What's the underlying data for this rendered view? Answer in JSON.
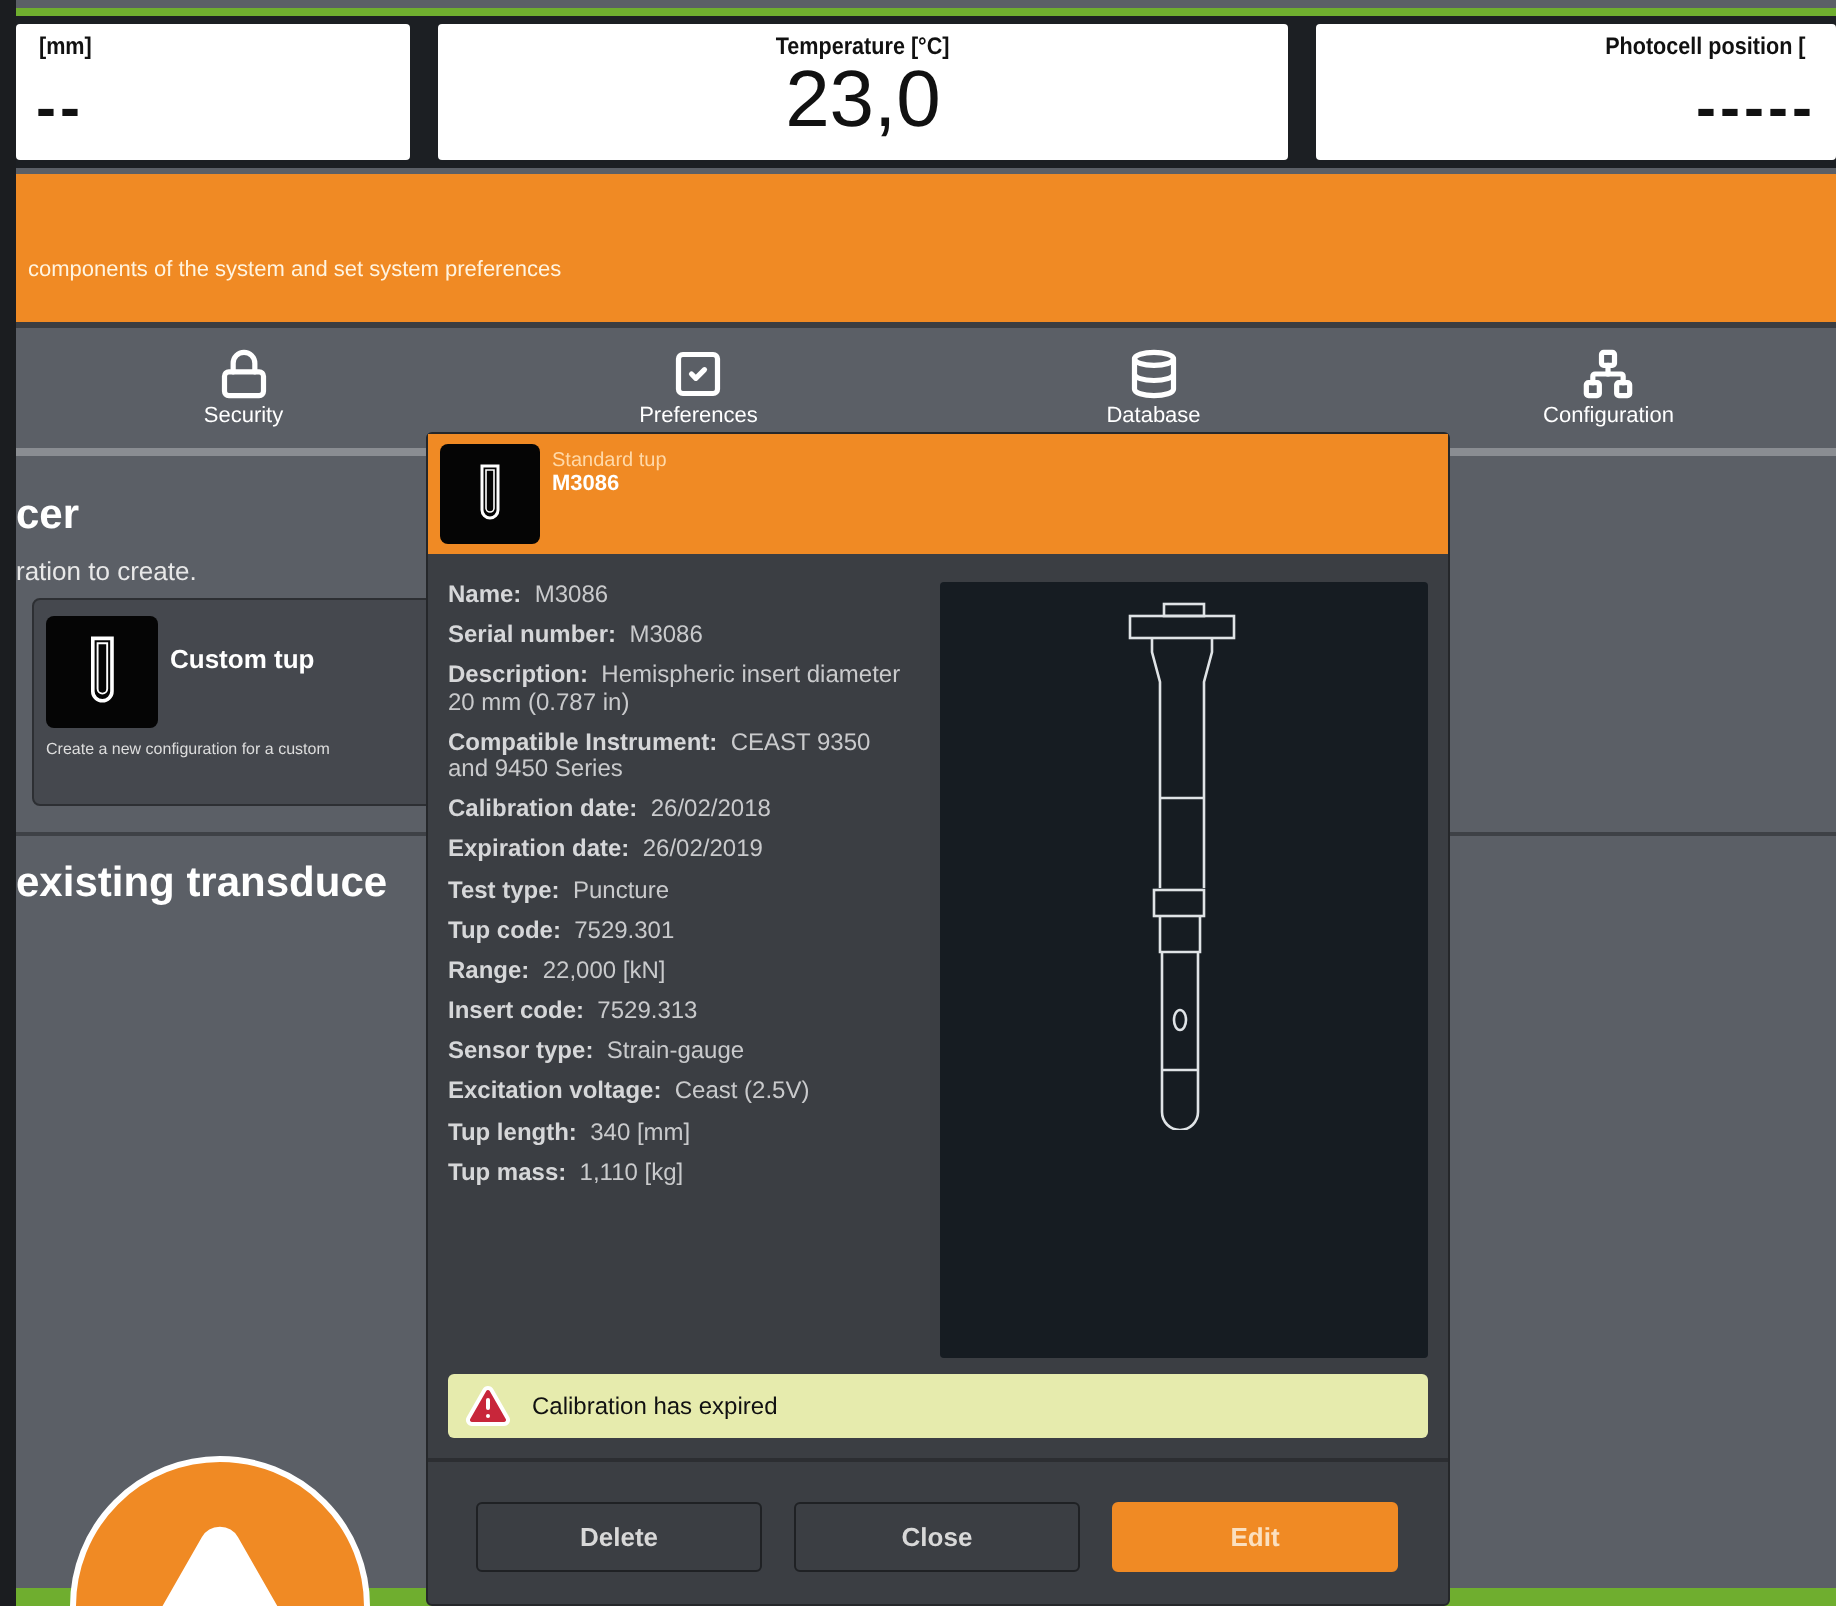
{
  "readouts": [
    {
      "label": "[mm]",
      "value": "--"
    },
    {
      "label": "Temperature  [°C]",
      "value": "23,0"
    },
    {
      "label": "Photocell position  [",
      "value": "-----"
    }
  ],
  "banner": {
    "text": "components of the system and set system preferences"
  },
  "tabs": [
    {
      "label": "Security",
      "kind": "lock"
    },
    {
      "label": "Preferences",
      "kind": "check"
    },
    {
      "label": "Database",
      "kind": "database"
    },
    {
      "label": "Configuration",
      "kind": "config"
    }
  ],
  "section": {
    "title": "cer",
    "subtitle": "ration to create.",
    "card": {
      "title": "Custom tup",
      "description": "Create a new configuration for a custom"
    },
    "title2": "existing transduce"
  },
  "dialog": {
    "category": "Standard tup",
    "name": "M3086",
    "fields": [
      "**Name:**  M3086",
      "**Serial number:**  M3086",
      "**Description:**  Hemispheric insert diameter 20 mm (0.787 in)",
      "**Compatible Instrument:**  CEAST 9350 and 9450 Series",
      "**Calibration date:**  26/02/2018",
      "**Expiration date:**  26/02/2019",
      "**Test type:**  Puncture",
      "**Tup code:**  7529.301",
      "**Range:**  22,000 [kN]",
      "**Insert code:**  7529.313",
      "**Sensor type:**  Strain-gauge",
      "**Excitation voltage:**  Ceast (2.5V)",
      "**Tup length:**  340 [mm]",
      "**Tup mass:**  1,110 [kg]"
    ],
    "alert": "Calibration has expired",
    "buttons": [
      {
        "label": "Delete",
        "kind": "secondary"
      },
      {
        "label": "Close",
        "kind": "secondary"
      },
      {
        "label": "Edit",
        "kind": "primary"
      }
    ]
  }
}
